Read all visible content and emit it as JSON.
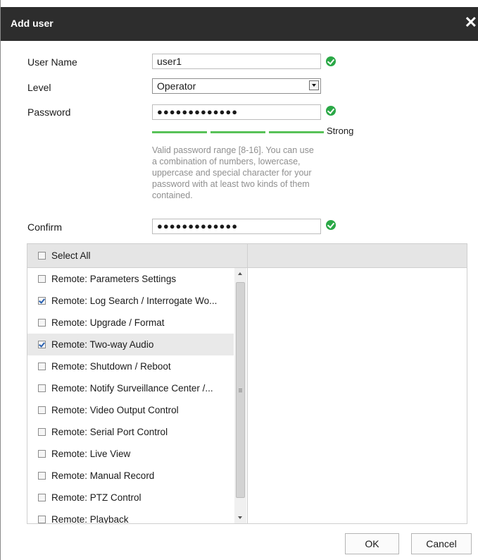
{
  "dialog": {
    "title": "Add user",
    "close_icon": "close-icon"
  },
  "form": {
    "username": {
      "label": "User Name",
      "value": "user1"
    },
    "level": {
      "label": "Level",
      "value": "Operator"
    },
    "password": {
      "label": "Password",
      "value": "●●●●●●●●●●●●●"
    },
    "strength": {
      "label": "Strong",
      "level": 3,
      "max": 3,
      "color": "#58c258"
    },
    "hint": "Valid password range [8-16]. You can use a combination of numbers, lowercase, uppercase and special character for your password with at least two kinds of them contained.",
    "confirm": {
      "label": "Confirm",
      "value": "●●●●●●●●●●●●●"
    }
  },
  "permissions": {
    "select_all_label": "Select All",
    "select_all_checked": false,
    "items": [
      {
        "label": "Remote: Parameters Settings",
        "checked": false
      },
      {
        "label": "Remote: Log Search / Interrogate Wo...",
        "checked": true
      },
      {
        "label": "Remote: Upgrade / Format",
        "checked": false
      },
      {
        "label": "Remote: Two-way Audio",
        "checked": true,
        "hovered": true
      },
      {
        "label": "Remote: Shutdown / Reboot",
        "checked": false
      },
      {
        "label": "Remote: Notify Surveillance Center /...",
        "checked": false
      },
      {
        "label": "Remote: Video Output Control",
        "checked": false
      },
      {
        "label": "Remote: Serial Port Control",
        "checked": false
      },
      {
        "label": "Remote: Live View",
        "checked": false
      },
      {
        "label": "Remote: Manual Record",
        "checked": false
      },
      {
        "label": "Remote: PTZ Control",
        "checked": false
      },
      {
        "label": "Remote: Playback",
        "checked": false
      }
    ]
  },
  "buttons": {
    "ok": "OK",
    "cancel": "Cancel"
  },
  "colors": {
    "titlebar": "#2d2d2d",
    "ok_check": "#2aa846",
    "checkbox_tick": "#2860b0"
  }
}
